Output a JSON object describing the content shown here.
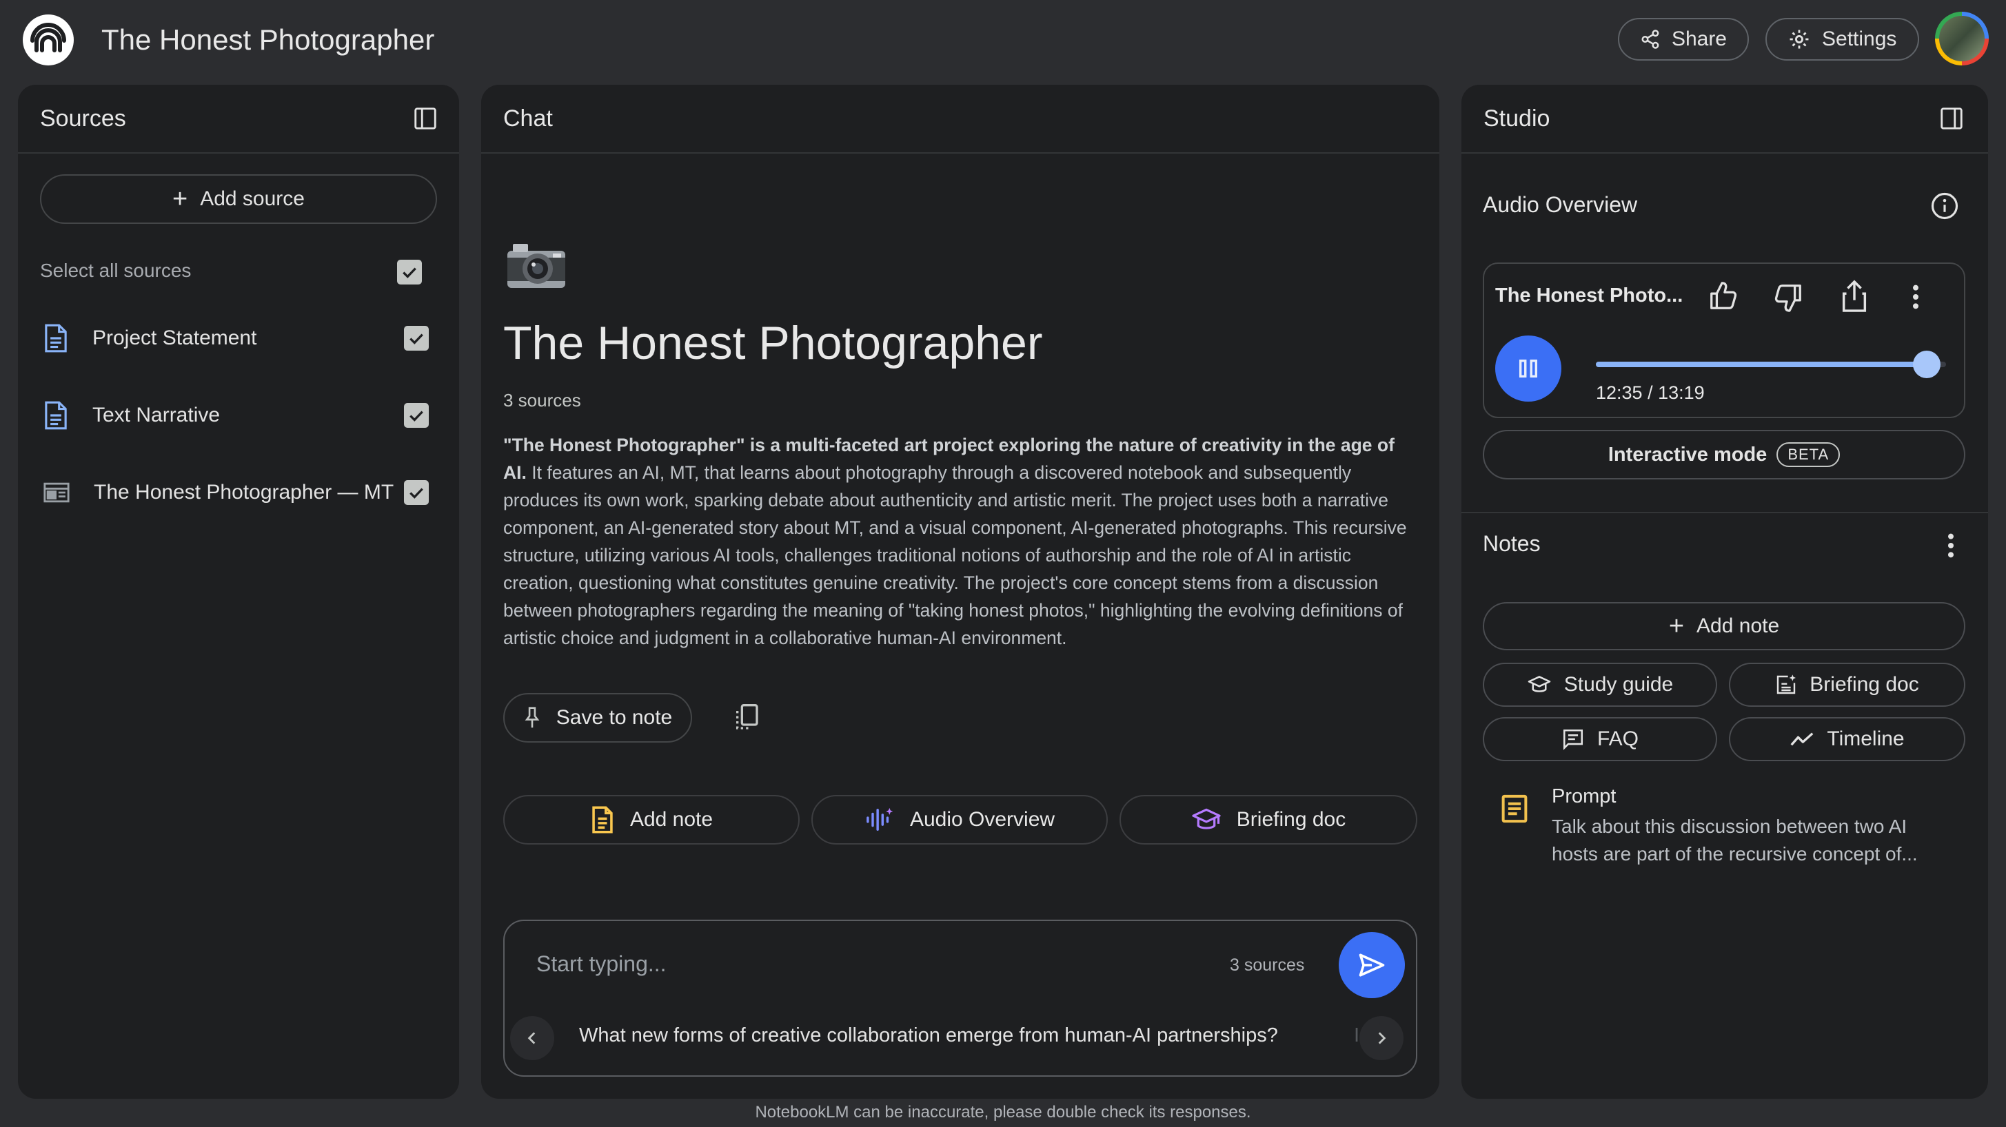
{
  "header": {
    "app_title": "The Honest Photographer",
    "share_label": "Share",
    "settings_label": "Settings"
  },
  "sources": {
    "title": "Sources",
    "add_source_label": "Add source",
    "select_all_label": "Select all sources",
    "items": [
      {
        "label": "Project Statement",
        "icon": "document-icon",
        "checked": true
      },
      {
        "label": "Text Narrative",
        "icon": "document-icon",
        "checked": true
      },
      {
        "label": "The Honest Photographer — MT",
        "icon": "web-page-icon",
        "checked": true
      }
    ]
  },
  "chat": {
    "title": "Chat",
    "emoji": "📷",
    "notebook_title": "The Honest Photographer",
    "source_count": "3 sources",
    "summary_bold": "\"The Honest Photographer\" is a multi-faceted art project exploring the nature of creativity in the age of AI.",
    "summary_rest": " It features an AI, MT, that learns about photography through a discovered notebook and subsequently produces its own work, sparking debate about authenticity and artistic merit. The project uses both a narrative component, an AI-generated story about MT, and a visual component, AI-generated photographs. This recursive structure, utilizing various AI tools, challenges traditional notions of authorship and the role of AI in artistic creation, questioning what constitutes genuine creativity. The project's core concept stems from a discussion between photographers regarding the meaning of \"taking honest photos,\" highlighting the evolving definitions of artistic choice and judgment in a collaborative human-AI environment.",
    "save_to_note_label": "Save to note",
    "actions": [
      {
        "label": "Add note",
        "icon": "note-icon",
        "color": "#f9c74f"
      },
      {
        "label": "Audio Overview",
        "icon": "audio-waveform-icon",
        "color": "#7b8cff"
      },
      {
        "label": "Briefing doc",
        "icon": "graduation-cap-icon",
        "color": "#b57bff"
      }
    ],
    "input_placeholder": "Start typing...",
    "input_source_count": "3 sources",
    "suggestion": "What new forms of creative collaboration emerge from human-AI partnerships?",
    "suggestion_partial_next": "I"
  },
  "studio": {
    "title": "Studio",
    "audio_overview_title": "Audio Overview",
    "audio_card_title": "The Honest Photo...",
    "time_display": "12:35 / 13:19",
    "progress_fraction": 0.945,
    "interactive_mode_label": "Interactive mode",
    "beta_badge": "BETA",
    "notes_title": "Notes",
    "add_note_label": "Add note",
    "note_buttons": [
      {
        "label": "Study guide",
        "icon": "graduation-cap-icon"
      },
      {
        "label": "Briefing doc",
        "icon": "document-sparkle-icon"
      },
      {
        "label": "FAQ",
        "icon": "chat-lines-icon"
      },
      {
        "label": "Timeline",
        "icon": "trend-line-icon"
      }
    ],
    "note": {
      "title": "Prompt",
      "body": "Talk about this discussion between two AI hosts are part of the recursive concept of..."
    }
  },
  "footer": {
    "disclaimer": "NotebookLM can be inaccurate, please double check its responses."
  },
  "colors": {
    "background": "#2c2d30",
    "panel": "#1e1f21",
    "accent_blue": "#3b6ff5",
    "progress_blue": "#8ab4f8",
    "note_yellow": "#f2c14e"
  }
}
